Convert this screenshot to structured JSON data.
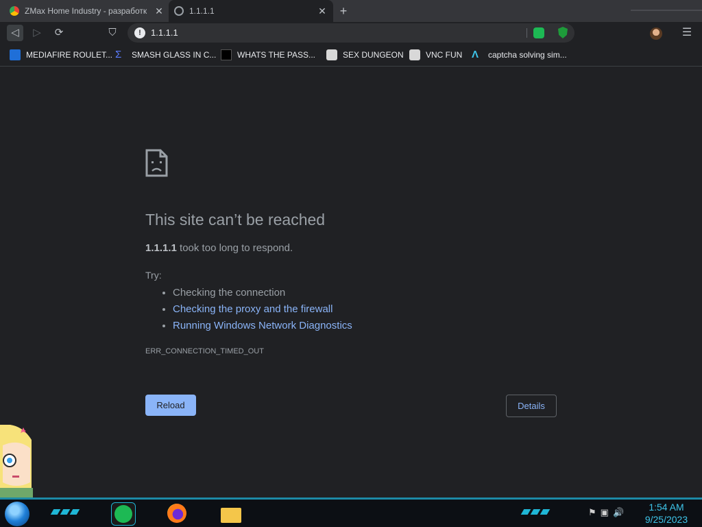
{
  "browser": {
    "tabs": [
      {
        "title": "ZMax Home Industry - разработк",
        "active": false,
        "icon": "chrome-tab-icon"
      },
      {
        "title": "1.1.1.1",
        "active": true,
        "icon": "globe-icon"
      }
    ],
    "address_bar": {
      "url": "1.1.1.1",
      "security_icon": "info-icon"
    },
    "bookmarks": [
      {
        "label": "MEDIAFIRE ROULET...",
        "icon": "bookmark-blue-icon"
      },
      {
        "label": "SMASH GLASS IN C...",
        "icon": "bookmark-sigma-icon"
      },
      {
        "label": "WHATS THE PASS...",
        "icon": "bookmark-dark-icon"
      },
      {
        "label": "SEX DUNGEON",
        "icon": "bookmark-bot-icon"
      },
      {
        "label": "VNC FUN",
        "icon": "bookmark-bot-icon"
      },
      {
        "label": "captcha solving sim...",
        "icon": "bookmark-arch-icon"
      }
    ]
  },
  "error_page": {
    "title": "This site can’t be reached",
    "host": "1.1.1.1",
    "description_suffix": " took too long to respond.",
    "try_label": "Try:",
    "suggestions": [
      {
        "text": "Checking the connection",
        "link": false
      },
      {
        "text": "Checking the proxy and the firewall",
        "link": true
      },
      {
        "text": "Running Windows Network Diagnostics",
        "link": true
      }
    ],
    "error_code": "ERR_CONNECTION_TIMED_OUT",
    "reload_label": "Reload",
    "details_label": "Details"
  },
  "taskbar": {
    "time": "1:54 AM",
    "date": "9/25/2023"
  },
  "colors": {
    "accent": "#8ab4f8",
    "taskbar_accent": "#1fb6d6",
    "page_bg": "#202124"
  }
}
